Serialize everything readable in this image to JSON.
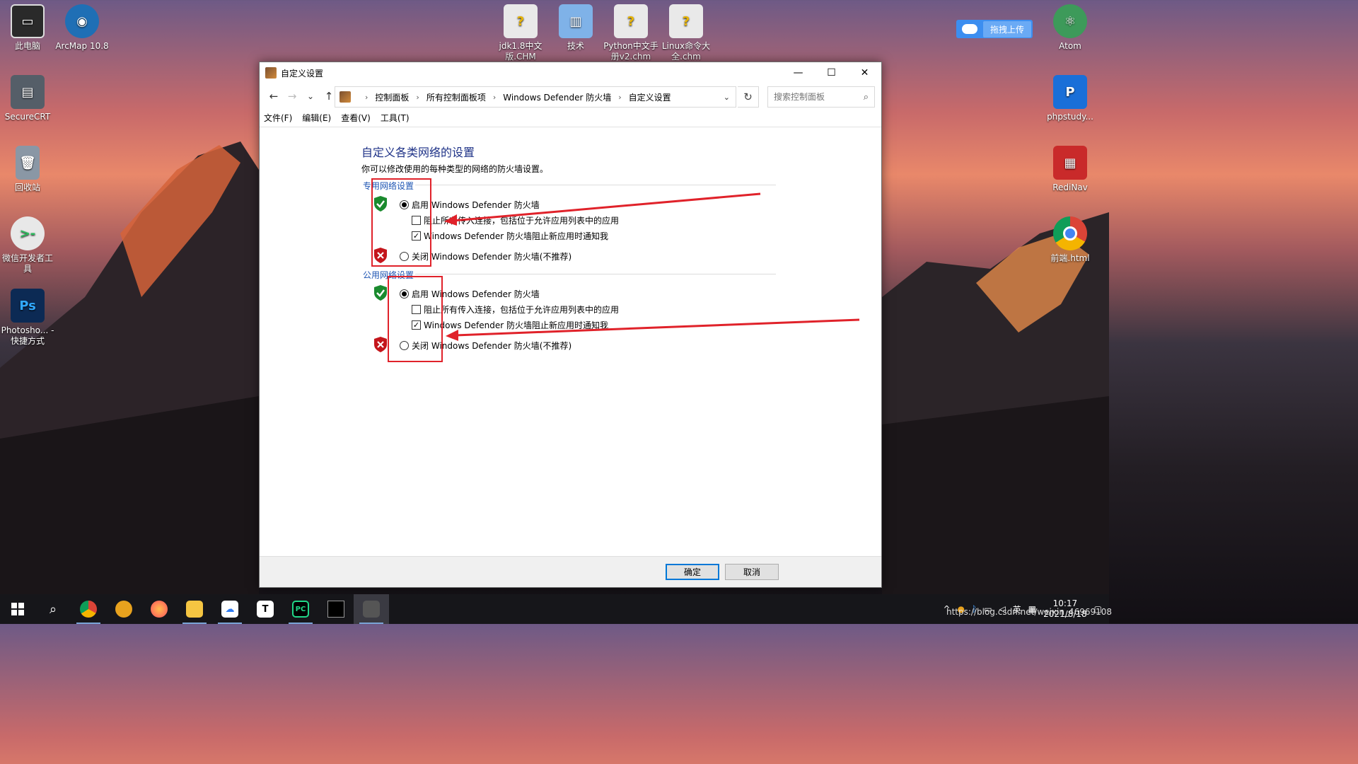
{
  "desktop": {
    "icons_left": [
      {
        "label": "此电脑",
        "icon": "monitor-icon",
        "color": "#2a2a2a"
      },
      {
        "label": "ArcMap 10.8",
        "icon": "globe-icon",
        "color": "#1f6fb5"
      },
      {
        "label": "SecureCRT",
        "icon": "terminal-icon",
        "color": "#555e68"
      },
      {
        "label": "回收站",
        "icon": "recycle-bin-icon",
        "color": "#8a97a5"
      },
      {
        "label": "微信开发者工具",
        "icon": "wechat-dev-icon",
        "color": "#e8e8e8"
      },
      {
        "label": "Photosho... - 快捷方式",
        "icon": "photoshop-icon",
        "color": "#0c2a54"
      }
    ],
    "icons_top": [
      {
        "label": "jdk1.8中文版.CHM",
        "icon": "chm-icon"
      },
      {
        "label": "技术",
        "icon": "folder-icon"
      },
      {
        "label": "Python中文手册v2.chm",
        "icon": "chm-icon"
      },
      {
        "label": "Linux命令大全.chm",
        "icon": "chm-icon"
      }
    ],
    "icons_right": [
      {
        "label": "Atom",
        "icon": "atom-icon",
        "color": "#3d9a5a"
      },
      {
        "label": "phpstudy...",
        "icon": "phpstudy-icon",
        "color": "#1a6fd8"
      },
      {
        "label": "RediNav",
        "icon": "redis-icon",
        "color": "#c92a2a"
      },
      {
        "label": "前端.html",
        "icon": "chrome-icon",
        "color": "#dedede"
      }
    ],
    "upload_button": "拖拽上传"
  },
  "window": {
    "title": "自定义设置",
    "controls": {
      "minimize": "—",
      "maximize": "☐",
      "close": "✕"
    },
    "nav": {
      "back": "←",
      "forward": "→",
      "recent": "⌄",
      "up": "↑"
    },
    "breadcrumb": [
      "控制面板",
      "所有控制面板项",
      "Windows Defender 防火墙",
      "自定义设置"
    ],
    "search_placeholder": "搜索控制面板",
    "menu": [
      "文件(F)",
      "编辑(E)",
      "查看(V)",
      "工具(T)"
    ],
    "heading": "自定义各类网络的设置",
    "description": "你可以修改使用的每种类型的网络的防火墙设置。",
    "private": {
      "label": "专用网络设置",
      "enable": "启用 Windows Defender 防火墙",
      "block_all": "阻止所有传入连接，包括位于允许应用列表中的应用",
      "notify": "Windows Defender 防火墙阻止新应用时通知我",
      "disable": "关闭 Windows Defender 防火墙(不推荐)"
    },
    "public": {
      "label": "公用网络设置",
      "enable": "启用 Windows Defender 防火墙",
      "block_all": "阻止所有传入连接，包括位于允许应用列表中的应用",
      "notify": "Windows Defender 防火墙阻止新应用时通知我",
      "disable": "关闭 Windows Defender 防火墙(不推荐)"
    },
    "buttons": {
      "ok": "确定",
      "cancel": "取消"
    }
  },
  "taskbar": {
    "apps": [
      "start-icon",
      "search-icon",
      "chrome-icon",
      "browser-icon",
      "firefox-icon",
      "file-explorer-icon",
      "baidu-netdisk-icon",
      "typora-icon",
      "pycharm-icon",
      "terminal-icon",
      "control-panel-icon"
    ],
    "ime": "英",
    "time": "10:17",
    "date": "2021/8/18"
  },
  "watermark": "https://blog.csdn.net/weixin_46969108"
}
